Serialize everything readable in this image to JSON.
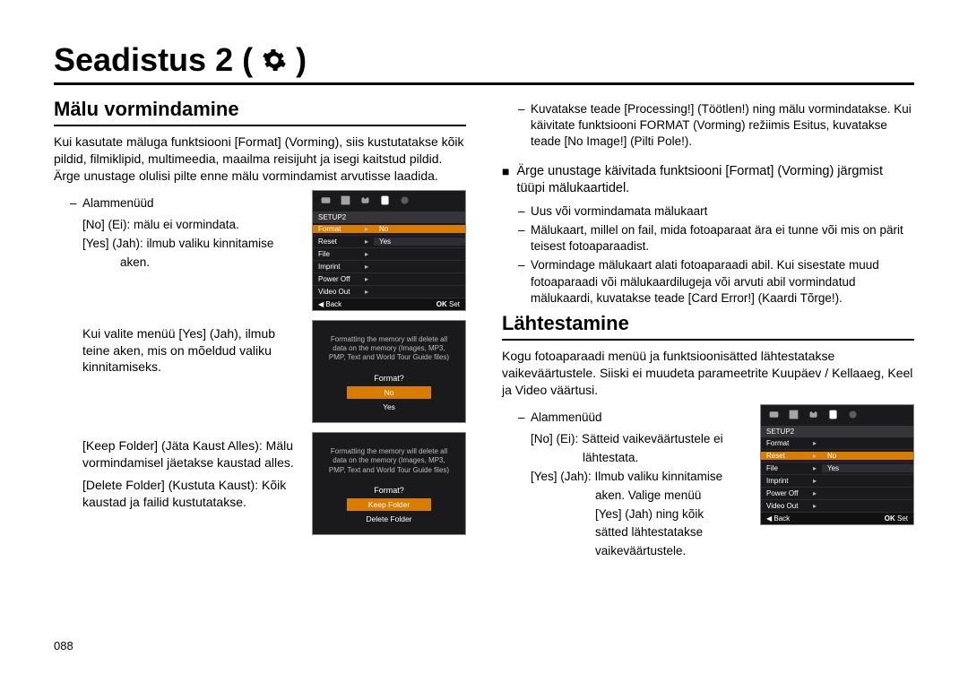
{
  "page_number": "088",
  "h1": "Seadistus 2 (",
  "h1_close": ")",
  "left": {
    "h2": "Mälu vormindamine",
    "intro": "Kui kasutate mäluga funktsiooni [Format] (Vorming), siis kustutatakse kõik pildid, filmiklipid, multimeedia, maailma reisijuht ja isegi kaitstud pildid. Ärge unustage olulisi pilte enne mälu vormindamist arvutisse laadida.",
    "sub_label": "Alammenüüd",
    "no_line": "[No] (Ei): mälu ei vormindata.",
    "yes_line1": "[Yes] (Jah): ilmub valiku kinnitamise",
    "yes_line2": "aken.",
    "p2": "Kui valite menüü [Yes] (Jah), ilmub teine aken, mis on mõeldud valiku kinnitamiseks.",
    "p3": "[Keep Folder] (Jäta Kaust Alles): Mälu vormindamisel jäetakse kaustad alles.",
    "p4": "[Delete Folder] (Kustuta Kaust): Kõik kaustad ja failid kustutatakse."
  },
  "right": {
    "top1": "Kuvatakse teade [Processing!] (Töötlen!) ning mälu vormindatakse. Kui käivitate funktsiooni FORMAT (Vorming) režiimis Esitus, kuvatakse teade [No Image!] (Pilti Pole!).",
    "sq": "Ärge unustage käivitada funktsiooni [Format] (Vorming) järgmist tüüpi mälukaartidel.",
    "li1": "Uus või vormindamata mälukaart",
    "li2": "Mälukaart, millel on fail, mida fotoaparaat ära ei tunne või mis on pärit teisest fotoaparaadist.",
    "li3": "Vormindage mälukaart alati fotoaparaadi abil. Kui sisestate muud fotoaparaadi või mälukaardilugeja või arvuti abil vormindatud mälukaardi, kuvatakse teade [Card Error!] (Kaardi Tõrge!).",
    "h2": "Lähtestamine",
    "intro": "Kogu fotoaparaadi menüü ja funktsioonisätted lähtestatakse vaikeväärtustele. Siiski ei muudeta parameetrite Kuupäev / Kellaaeg, Keel ja Video väärtusi.",
    "sub_label": "Alammenüüd",
    "rno1": "[No] (Ei): Sätteid vaikeväärtustele ei",
    "rno2": "lähtestata.",
    "ryes1": "[Yes] (Jah): Ilmub valiku kinnitamise",
    "ryes2": "aken. Valige menüü",
    "ryes3": "[Yes] (Jah) ning kõik",
    "ryes4": "sätted lähtestatakse",
    "ryes5": "vaikeväärtustele."
  },
  "lcd": {
    "title": "SETUP2",
    "items": [
      "Format",
      "Reset",
      "File",
      "Imprint",
      "Power Off",
      "Video Out"
    ],
    "back": "Back",
    "ok": "OK",
    "set": "Set",
    "vals": {
      "no": "No",
      "yes": "Yes"
    },
    "confirm_msg": "Formatting the memory will delete all data on the memory (Images, MP3, PMP, Text and World Tour Guide files)",
    "confirm_q1": "Format?",
    "confirm_no": "No",
    "confirm_yes": "Yes",
    "confirm_keep": "Keep Folder",
    "confirm_delete": "Delete Folder"
  }
}
